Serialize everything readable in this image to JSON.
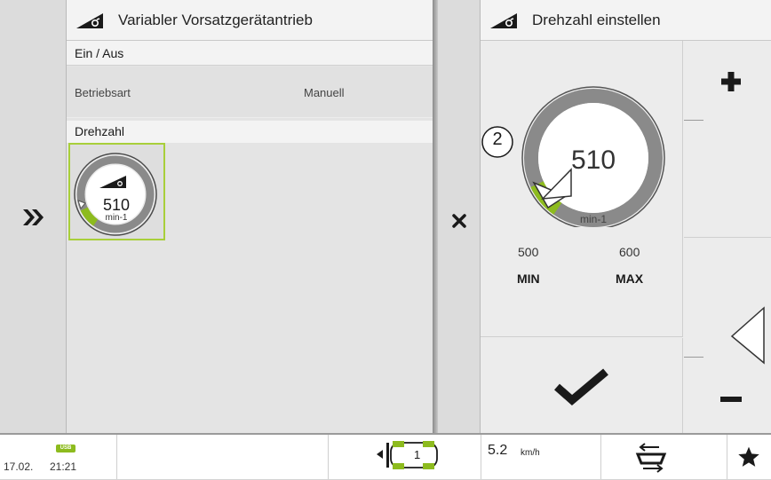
{
  "left_panel": {
    "title": "Variabler Vorsatzgerätantrieb",
    "row_onoff": "Ein / Aus",
    "mode_label": "Betriebsart",
    "mode_value": "Manuell",
    "speed_section": "Drehzahl",
    "gauge_value": "510",
    "gauge_unit": "min-1"
  },
  "nav": {
    "expand_icon": "double-chevron-right-icon",
    "close_icon": "x-icon"
  },
  "dialog": {
    "title": "Drehzahl einstellen",
    "badge": "2",
    "gauge_value": "510",
    "gauge_unit": "min-1",
    "min_value": "500",
    "max_value": "600",
    "min_label": "MIN",
    "max_label": "MAX",
    "level_fraction": 0.1
  },
  "status": {
    "usb_label": "USB",
    "date": "17.02.",
    "time": "21:21",
    "implement_number": "1",
    "speed": "5.2",
    "speed_unit": "km/h"
  },
  "colors": {
    "accent_green": "#8dbb1e",
    "gauge_gray": "#8a8a8a"
  }
}
